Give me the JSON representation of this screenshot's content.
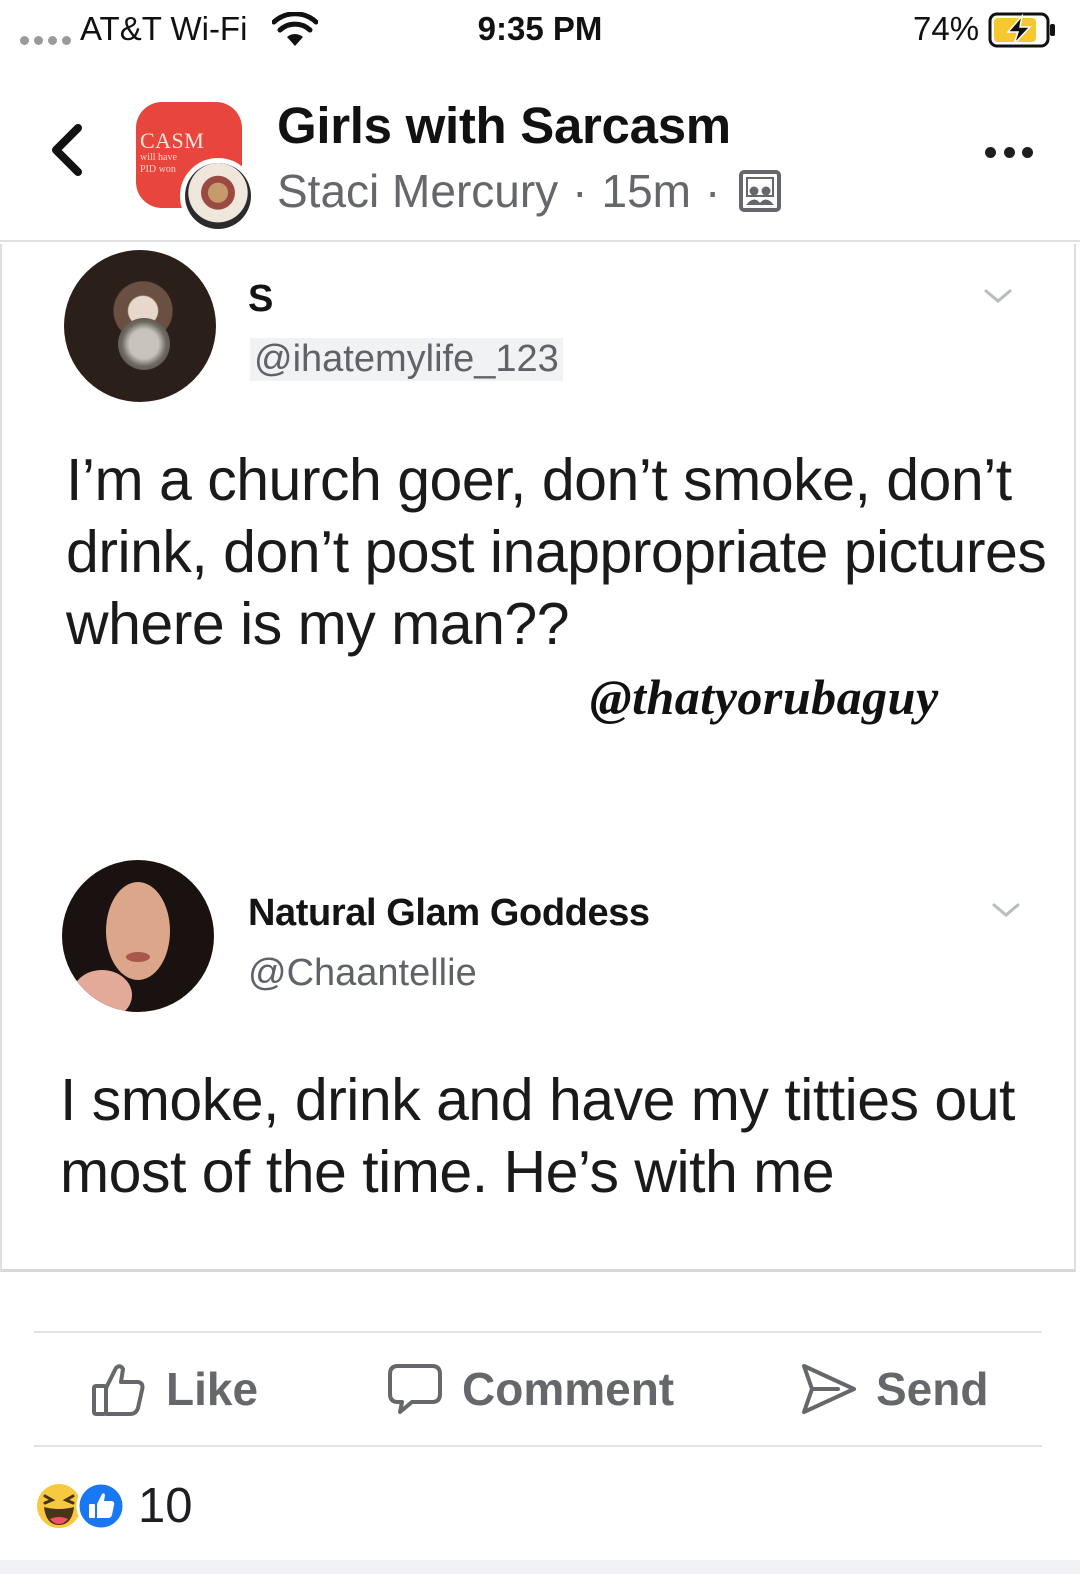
{
  "status_bar": {
    "carrier": "AT&T Wi-Fi",
    "time": "9:35 PM",
    "battery": "74%"
  },
  "header": {
    "group_name": "Girls with Sarcasm",
    "author": "Staci Mercury",
    "separator": "·",
    "time_ago": "15m",
    "avatar_text": "CASM",
    "avatar_subtext": "will have\nPID won"
  },
  "post": {
    "tweets": [
      {
        "name": "S",
        "handle": "@ihatemylife_123",
        "text": "I’m a church goer, don’t smoke, don’t drink, don’t post inappropriate pictures where is my man??"
      },
      {
        "name": "Natural Glam Goddess",
        "handle": "@Chaantellie",
        "text": "I smoke, drink and have my titties out most of the time. He’s with me"
      }
    ],
    "watermark": "@thatyorubaguy"
  },
  "actions": {
    "like": "Like",
    "comment": "Comment",
    "send": "Send"
  },
  "reactions": {
    "count": "10",
    "types": [
      "haha-icon",
      "like-icon"
    ]
  },
  "colors": {
    "meta_gray": "#65676b",
    "avatar_red": "#e8463c",
    "like_blue": "#1877f2",
    "haha_yellow": "#f7c93e"
  }
}
